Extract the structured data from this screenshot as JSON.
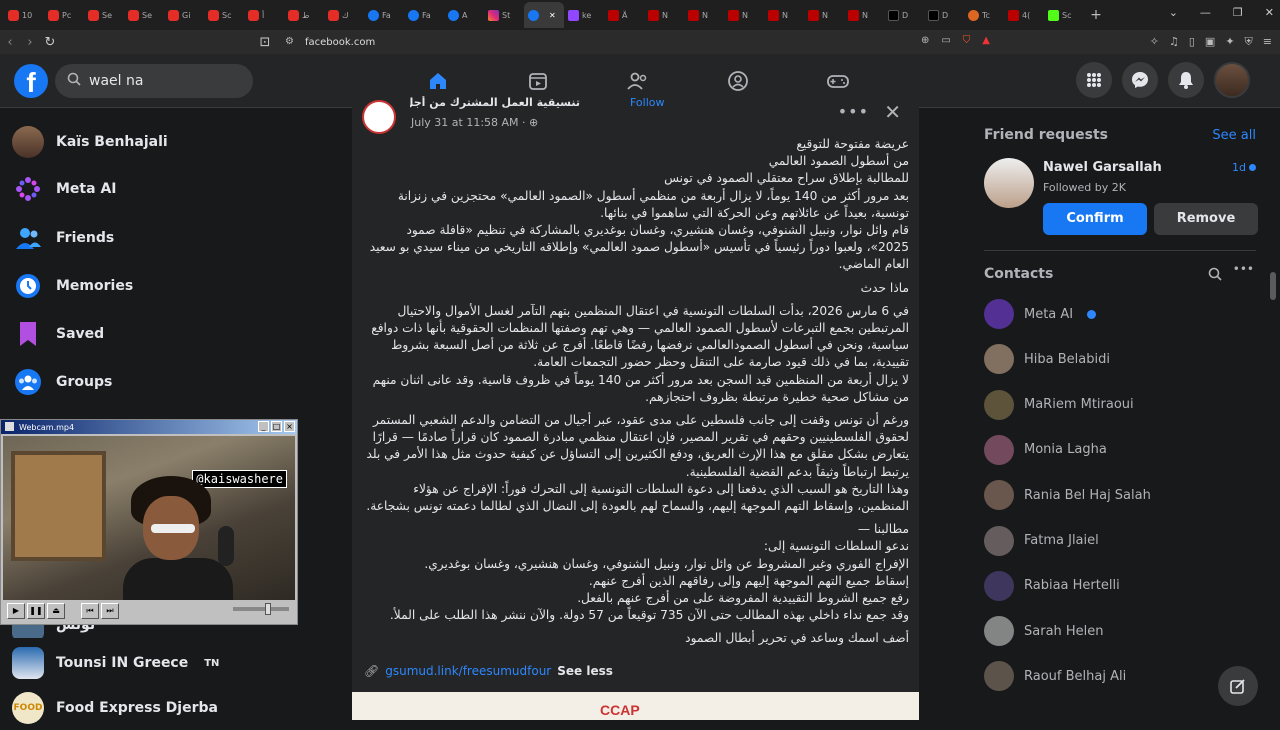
{
  "browser": {
    "tabs": [
      {
        "icon": "youtube-icon",
        "label": "10",
        "fav": "yt"
      },
      {
        "icon": "youtube-icon",
        "label": "Pc",
        "fav": "yt"
      },
      {
        "icon": "youtube-icon",
        "label": "Se",
        "fav": "yt"
      },
      {
        "icon": "youtube-icon",
        "label": "Se",
        "fav": "yt"
      },
      {
        "icon": "youtube-icon",
        "label": "Gi",
        "fav": "yt"
      },
      {
        "icon": "youtube-icon",
        "label": "Sc",
        "fav": "yt"
      },
      {
        "icon": "youtube-icon",
        "label": "أ",
        "fav": "yt"
      },
      {
        "icon": "youtube-icon",
        "label": "ط",
        "fav": "yt"
      },
      {
        "icon": "youtube-icon",
        "label": "ك",
        "fav": "yt"
      },
      {
        "icon": "facebook-icon",
        "label": "Fa",
        "fav": "fb"
      },
      {
        "icon": "facebook-icon",
        "label": "Fa",
        "fav": "fb"
      },
      {
        "icon": "facebook-icon",
        "label": "A",
        "fav": "fb"
      },
      {
        "icon": "instagram-icon",
        "label": "St",
        "fav": "ig"
      },
      {
        "icon": "facebook-icon",
        "label": "",
        "fav": "fb",
        "active": true
      },
      {
        "icon": "twitch-icon",
        "label": "ke",
        "fav": "tw"
      },
      {
        "icon": "news-icon",
        "label": "Ä",
        "fav": "ne"
      },
      {
        "icon": "news-icon",
        "label": "N",
        "fav": "ne"
      },
      {
        "icon": "news-icon",
        "label": "N",
        "fav": "ne"
      },
      {
        "icon": "news-icon",
        "label": "N",
        "fav": "ne"
      },
      {
        "icon": "news-icon",
        "label": "N",
        "fav": "ne"
      },
      {
        "icon": "news-icon",
        "label": "N",
        "fav": "ne"
      },
      {
        "icon": "news-icon",
        "label": "N",
        "fav": "ne"
      },
      {
        "icon": "x-icon",
        "label": "D",
        "fav": "x"
      },
      {
        "icon": "x-icon",
        "label": "D",
        "fav": "x"
      },
      {
        "icon": "reddit-icon",
        "label": "Tc",
        "fav": "r"
      },
      {
        "icon": "news-icon",
        "label": "4(",
        "fav": "ne"
      },
      {
        "icon": "kick-icon",
        "label": "Sc",
        "fav": "k"
      }
    ],
    "url": "facebook.com"
  },
  "header": {
    "search_query": "wael na"
  },
  "sidebar": {
    "items": [
      {
        "label": "Kaïs Benhajali",
        "icon": "profile-avatar",
        "color": "#6b4a3a"
      },
      {
        "label": "Meta AI",
        "icon": "meta-ai-icon",
        "color": "#7b3fe4"
      },
      {
        "label": "Friends",
        "icon": "friends-icon",
        "color": "#1877f2"
      },
      {
        "label": "Memories",
        "icon": "memories-icon",
        "color": "#1877f2"
      },
      {
        "label": "Saved",
        "icon": "saved-icon",
        "color": "#a33de8"
      },
      {
        "label": "Groups",
        "icon": "groups-icon",
        "color": "#1877f2"
      }
    ],
    "lower_items": [
      {
        "label": "تونس",
        "sub": ""
      },
      {
        "label": "Tounsi IN Greece",
        "sub": "TN"
      },
      {
        "label": "Food Express Djerba",
        "sub": ""
      }
    ]
  },
  "webcam": {
    "title": "Webcam.mp4",
    "overlay_tag": "@kaiswashere",
    "seek_fraction": 0.62
  },
  "post": {
    "page_name": "تنسيقية العمل المشترك من أجل فلسطين",
    "follow": "Follow",
    "date": "July 31 at 11:58 AM",
    "paragraphs": [
      "عريضة مفتوحة للتوقيع\nمن أسطول الصمود العالمي\nللمطالبة بإطلاق سراح معتقلي الصمود في تونس\nبعد مرور أكثر من 140 يوماً، لا يزال أربعة من منظمي أسطول «الصمود العالمي» محتجزين في زنزانة تونسية، بعيداً عن عائلاتهم وعن الحركة التي ساهموا في بنائها.\nقام وائل نوار، ونبيل الشنوفي، وغسان هنشيري، وغسان بوغديري بالمشاركة في تنظيم «قافلة صمود 2025»، ولعبوا دوراً رئيسياً في تأسيس «أسطول صمود العالمي» وإطلاقه التاريخي من ميناء سيدي بو سعيد العام الماضي.",
      "ماذا حدث",
      "في 6 مارس 2026، بدأت السلطات التونسية في اعتقال المنظمين بتهم التآمر لغسل الأموال والاحتيال المرتبطين بجمع التبرعات لأسطول الصمود العالمي — وهي تهم وصفتها المنظمات الحقوقية بأنها ذات دوافع سياسية، ونحن في أسطول الصمودالعالمي نرفضها رفضًا قاطعًا. أفرج عن ثلاثة من أصل السبعة بشروط تقييدية، بما في ذلك قيود صارمة على التنقل وحظر حضور التجمعات العامة.\nلا يزال أربعة من المنظمين قيد السجن بعد مرور أكثر من 140 يوماً في ظروف قاسية. وقد عانى اثنان منهم من مشاكل صحية خطيرة مرتبطة بظروف احتجازهم.",
      "ورغم أن تونس وقفت إلى جانب فلسطين على مدى عقود، عبر أجيال من التضامن والدعم الشعبي المستمر لحقوق الفلسطينيين وحقهم في تقرير المصير، فإن اعتقال منظمي مبادرة الصمود كان قراراً صادمًا — قرارًا يتعارض بشكل مقلق مع هذا الإرث العريق، ودفع الكثيرين إلى التساؤل عن كيفية حدوث مثل هذا الأمر في بلد يرتبط ارتباطاً وثيقاً بدعم القضية الفلسطينية.\nوهذا التاريخ هو السبب الذي يدفعنا إلى دعوة السلطات التونسية إلى التحرك فوراً: الإفراج عن هؤلاء المنظمين، وإسقاط التهم الموجهة إليهم، والسماح لهم بالعودة إلى النضال الذي لطالما دعمته تونس بشجاعة.",
      "مطالبنا —\nندعو السلطات التونسية إلى:\nالإفراج الفوري وغير المشروط عن وائل نوار، ونبيل الشنوفي، وغسان هنشيري، وغسان بوغديري.\nإسقاط جميع التهم الموجهة إليهم وإلى رفاقهم الذين أفرج عنهم.\nرفع جميع الشروط التقييدية المفروضة على من أفرج عنهم بالفعل.\nوقد جمع نداء داخلي بهذه المطالب حتى الآن 735 توقيعاً من 57 دولة. والآن ننشر هذا الطلب على الملأ.",
      "أضف اسمك وساعد في تحرير أبطال  الصمود"
    ],
    "link": "gsumud.link/freesumudfour",
    "see_less": "See less",
    "image_text": "CCAP"
  },
  "rightbar": {
    "friend_requests_title": "Friend requests",
    "see_all": "See all",
    "request": {
      "name": "Nawel Garsallah",
      "meta": "Followed by 2K",
      "time": "1d",
      "confirm": "Confirm",
      "remove": "Remove"
    },
    "contacts_title": "Contacts",
    "contacts": [
      {
        "name": "Meta AI",
        "color": "#7b3fe4",
        "verified": true
      },
      {
        "name": "Hiba Belabidi",
        "color": "#c8a890"
      },
      {
        "name": "MaRiem Mtiraoui",
        "color": "#8a7a50"
      },
      {
        "name": "Monia Lagha",
        "color": "#b06a8a"
      },
      {
        "name": "Rania Bel Haj Salah",
        "color": "#a08070"
      },
      {
        "name": "Fatma Jlaiel",
        "color": "#9a8a8a"
      },
      {
        "name": "Rabiaa Hertelli",
        "color": "#5a4a8a"
      },
      {
        "name": "Sarah Helen",
        "color": "#ccc"
      },
      {
        "name": "Raouf Belhaj Ali",
        "color": "#8a7a6a"
      }
    ]
  }
}
